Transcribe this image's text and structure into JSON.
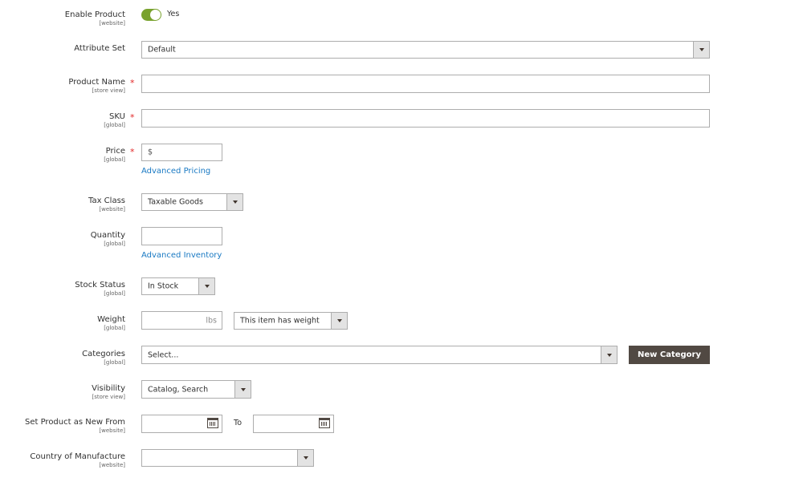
{
  "enable_product": {
    "label": "Enable Product",
    "scope": "[website]",
    "value": "Yes",
    "enabled": true
  },
  "attribute_set": {
    "label": "Attribute Set",
    "value": "Default"
  },
  "product_name": {
    "label": "Product Name",
    "scope": "[store view]",
    "value": ""
  },
  "sku": {
    "label": "SKU",
    "scope": "[global]",
    "value": ""
  },
  "price": {
    "label": "Price",
    "scope": "[global]",
    "currency": "$",
    "link": "Advanced Pricing"
  },
  "tax_class": {
    "label": "Tax Class",
    "scope": "[website]",
    "value": "Taxable Goods"
  },
  "quantity": {
    "label": "Quantity",
    "scope": "[global]",
    "value": "",
    "link": "Advanced Inventory"
  },
  "stock_status": {
    "label": "Stock Status",
    "scope": "[global]",
    "value": "In Stock"
  },
  "weight": {
    "label": "Weight",
    "scope": "[global]",
    "unit": "lbs",
    "option": "This item has weight"
  },
  "categories": {
    "label": "Categories",
    "scope": "[global]",
    "placeholder": "Select...",
    "button": "New Category"
  },
  "visibility": {
    "label": "Visibility",
    "scope": "[store view]",
    "value": "Catalog, Search"
  },
  "new_from": {
    "label": "Set Product as New From",
    "scope": "[website]",
    "to_label": "To"
  },
  "country": {
    "label": "Country of Manufacture",
    "scope": "[website]",
    "value": ""
  },
  "colors": {
    "toggle_on": "#79a22e",
    "link": "#1979c3",
    "required": "#e22626",
    "button_bg": "#514943"
  }
}
